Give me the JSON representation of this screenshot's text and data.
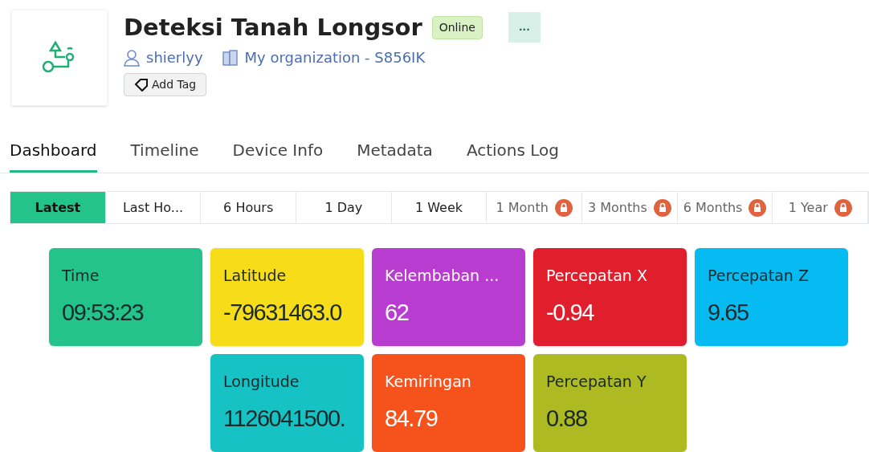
{
  "device": {
    "title": "Deteksi Tanah Longsor",
    "status": "Online",
    "more": "...",
    "owner": "shierlyy",
    "organization": "My organization - S856IK",
    "add_tag": "Add Tag"
  },
  "tabs": [
    {
      "label": "Dashboard",
      "selected": true
    },
    {
      "label": "Timeline",
      "selected": false
    },
    {
      "label": "Device Info",
      "selected": false
    },
    {
      "label": "Metadata",
      "selected": false
    },
    {
      "label": "Actions Log",
      "selected": false
    }
  ],
  "time_ranges": [
    {
      "label": "Latest",
      "selected": true,
      "locked": false
    },
    {
      "label": "Last Ho...",
      "selected": false,
      "locked": false
    },
    {
      "label": "6 Hours",
      "selected": false,
      "locked": false
    },
    {
      "label": "1 Day",
      "selected": false,
      "locked": false
    },
    {
      "label": "1 Week",
      "selected": false,
      "locked": false
    },
    {
      "label": "1 Month",
      "selected": false,
      "locked": true
    },
    {
      "label": "3 Months",
      "selected": false,
      "locked": true
    },
    {
      "label": "6 Months",
      "selected": false,
      "locked": true
    },
    {
      "label": "1 Year",
      "selected": false,
      "locked": true
    }
  ],
  "widget_rows": [
    [
      {
        "label": "Time",
        "value": "09:53:23",
        "color": "#24c38b",
        "light_text": false
      },
      {
        "label": "Latitude",
        "value": "-79631463.0",
        "color": "#f7dc19",
        "light_text": false
      },
      {
        "label": "Kelembaban ...",
        "value": "62",
        "color": "#b83ccf",
        "light_text": true
      },
      {
        "label": "Percepatan X",
        "value": "-0.94",
        "color": "#e11f2c",
        "light_text": true
      },
      {
        "label": "Percepatan Z",
        "value": "9.65",
        "color": "#06bbf2",
        "light_text": false
      }
    ],
    [
      {
        "label": "Longitude",
        "value": "1126041500.",
        "color": "#16c2c3",
        "light_text": false
      },
      {
        "label": "Kemiringan",
        "value": "84.79",
        "color": "#f5521c",
        "light_text": true
      },
      {
        "label": "Percepatan Y",
        "value": "0.88",
        "color": "#adba21",
        "light_text": false
      }
    ]
  ]
}
